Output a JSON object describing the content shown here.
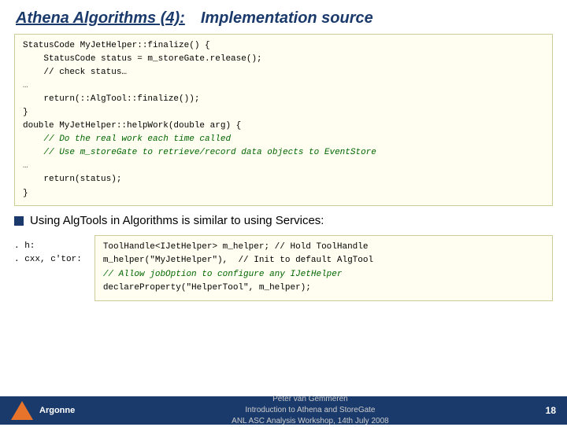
{
  "header": {
    "title_left": "Athena Algorithms (4):",
    "title_right": "Implementation source"
  },
  "code_top": {
    "lines": [
      {
        "text": "StatusCode MyJetHelper::finalize() {",
        "type": "normal"
      },
      {
        "text": "    StatusCode status = m_storeGate.release();",
        "type": "normal"
      },
      {
        "text": "    // check status…",
        "type": "normal"
      },
      {
        "text": "…",
        "type": "ellipsis"
      },
      {
        "text": "    return(::AlgTool::finalize());",
        "type": "normal"
      },
      {
        "text": "}",
        "type": "normal"
      },
      {
        "text": "double MyJetHelper::helpWork(double arg) {",
        "type": "normal"
      },
      {
        "text": "    // Do the real work each time called",
        "type": "green"
      },
      {
        "text": "    // Use m_storeGate to retrieve/record data objects to EventStore",
        "type": "green"
      },
      {
        "text": "…",
        "type": "ellipsis"
      },
      {
        "text": "    return(status);",
        "type": "normal"
      },
      {
        "text": "}",
        "type": "normal"
      }
    ]
  },
  "bullet": {
    "text": "Using AlgTools in Algorithms is similar to using Services:"
  },
  "bottom_labels": {
    "h_label": ". h:",
    "cxx_label": ". cxx, c'tor:"
  },
  "bottom_code": {
    "lines": [
      {
        "text": "ToolHandle<IJetHelper> m_helper; // Hold ToolHandle",
        "type": "normal"
      },
      {
        "text": "m_helper(\"MyJetHelper\"), // Init to default AlgTool",
        "type": "normal"
      },
      {
        "text": "// Allow jobOption to configure any IJetHelper",
        "type": "green"
      },
      {
        "text": "declareProperty(\"HelperTool\", m_helper);",
        "type": "normal"
      }
    ]
  },
  "footer": {
    "logo_text": "Argonne",
    "center_line1": "Peter van Gemmeren",
    "center_line2": "Introduction to Athena and StoreGate",
    "center_line3": "ANL ASC Analysis Workshop, 14th July 2008",
    "page_number": "18"
  }
}
